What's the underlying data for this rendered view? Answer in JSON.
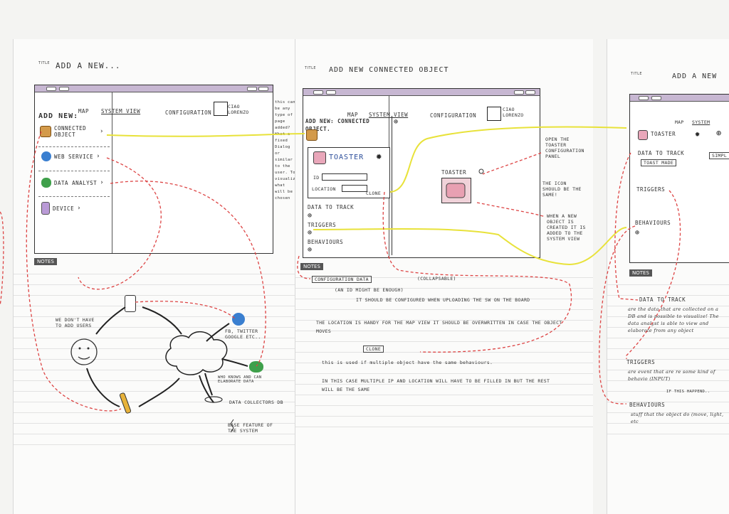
{
  "page1": {
    "title_label": "TITLE",
    "title": "ADD A NEW...",
    "nav": [
      "MAP",
      "SYSTEM VIEW",
      "CONFIGURATION"
    ],
    "user": "CIAO LORENZO",
    "add_new": "ADD NEW:",
    "items": [
      "CONNECTED OBJECT",
      "WEB SERVICE",
      "DATA ANALYST",
      "DEVICE"
    ],
    "margin_note": "this can be any type of page added? What a fixed Dialog or similar to the user. To visualize what will be chosen",
    "notes_label": "NOTES",
    "diagram": {
      "we_dont": "WE DON'T HAVE TO ADD USERS",
      "fb": "FB, TWITTER GOOGLE ETC..",
      "who_knows": "WHO KNOWS AND CAN ELABORATE DATA",
      "db": "DATA COLLECTORS DB",
      "base": "BASE FEATURE OF THE SYSTEM"
    }
  },
  "page2": {
    "title_label": "TITLE",
    "title": "ADD NEW CONNECTED OBJECT",
    "nav": [
      "MAP",
      "SYSTEM VIEW",
      "CONFIGURATION"
    ],
    "user": "CIAO LORENZO",
    "panel_title": "ADD NEW: CONNECTED OBJECT.",
    "object_name": "TOASTER",
    "id_label": "ID",
    "location_label": "LOCATION",
    "clone_label": "CLONE",
    "data_to_track": "DATA TO TRACK",
    "triggers": "TRIGGERS",
    "behaviours": "BEHAVIOURS",
    "toaster_map": "TOASTER",
    "annotation_open": "OPEN THE TOASTER CONFIGURATION PANEL",
    "annotation_icon": "THE ICON SHOULD BE THE SAME!",
    "annotation_new": "WHEN A NEW OBJECT IS CREATED IT IS ADDED TO THE SYSTEM VIEW",
    "notes_label": "NOTES",
    "notes": {
      "config_data": "CONFIGURATION DATA",
      "collapsable": "(COLLAPSABLE)",
      "id_line": "(AN ID MIGHT BE ENOUGH)",
      "should_line": "IT SHOULD BE CONFIGURED WHEN UPLOADING THE SW ON THE BOARD",
      "location_line": "THE LOCATION IS HANDY FOR THE MAP VIEW IT SHOULD BE OVERWRITTEN IN CASE THE OBJECT MOVES",
      "clone": "CLONE",
      "used_line": "this is used if multiple object have the same behaviours.",
      "case_line": "IN THIS CASE MULTIPLE IP AND LOCATION WILL HAVE TO BE FILLED IN BUT THE REST WILL BE THE SAME"
    }
  },
  "page3": {
    "title_label": "TITLE",
    "title": "ADD A NEW",
    "object_name": "TOASTER",
    "data_to_track": "DATA TO TRACK",
    "toast_made": "TOAST MADE",
    "simple": "SIMPL",
    "triggers": "TRIGGERS",
    "behaviours": "BEHAVIOURS",
    "nav": [
      "MAP",
      "SYSTEM"
    ],
    "notes_label": "NOTES",
    "notes": {
      "dtt_head": "DATA TO TRACK",
      "dtt_body": "are the data that are collected on a DB and is possible to visualize! The data analyst is able to view and elaborate from any object",
      "trig_head": "TRIGGERS",
      "trig_body": "are event that are re some kind of behavio (INPUT)",
      "if_this": "IF THIS HAPPEND..",
      "beh_head": "BEHAVIOURS",
      "beh_body": "stuff that the object do (move, light, etc"
    }
  }
}
